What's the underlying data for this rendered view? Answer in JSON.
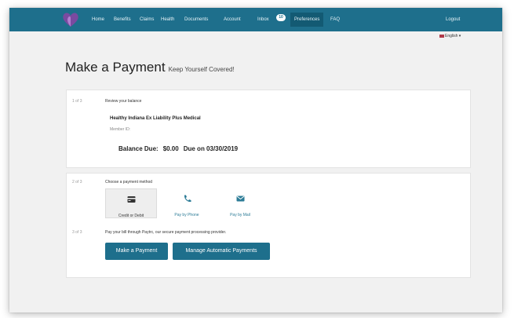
{
  "nav": {
    "items": [
      "Home",
      "Benefits",
      "Claims",
      "Health",
      "Documents",
      "Account",
      "Inbox",
      "Preferences",
      "FAQ"
    ],
    "inbox_badge": "10",
    "logout": "Logout"
  },
  "language": {
    "selected": "English"
  },
  "header": {
    "title": "Make a Payment",
    "subtitle": "Keep Yourself Covered!"
  },
  "steps": [
    {
      "number": "1 of 3",
      "label": "Review your balance"
    },
    {
      "number": "2 of 3",
      "label": "Choose a payment method"
    },
    {
      "number": "3 of 3",
      "label": "Pay your bill through Paytrc, our secure payment processing provider."
    }
  ],
  "balance_card": {
    "plan_name": "Healthy Indiana Ex Liability Plus Medical",
    "member_id_label": "Member ID:",
    "balance_label": "Balance Due:",
    "balance_value": "$0.00",
    "due_date": "Due on 03/30/2019"
  },
  "payment_methods": [
    {
      "label": "Credit or Debit",
      "icon": "credit-card-icon",
      "selected": true
    },
    {
      "label": "Pay by Phone",
      "icon": "phone-icon",
      "selected": false
    },
    {
      "label": "Pay by Mail",
      "icon": "mail-icon",
      "selected": false
    }
  ],
  "buttons": {
    "make_payment": "Make a Payment",
    "manage_auto": "Manage Automatic Payments"
  },
  "colors": {
    "navbar": "#1e6f8c",
    "button": "#1e6f8c",
    "logo": "#7a4aa0"
  }
}
